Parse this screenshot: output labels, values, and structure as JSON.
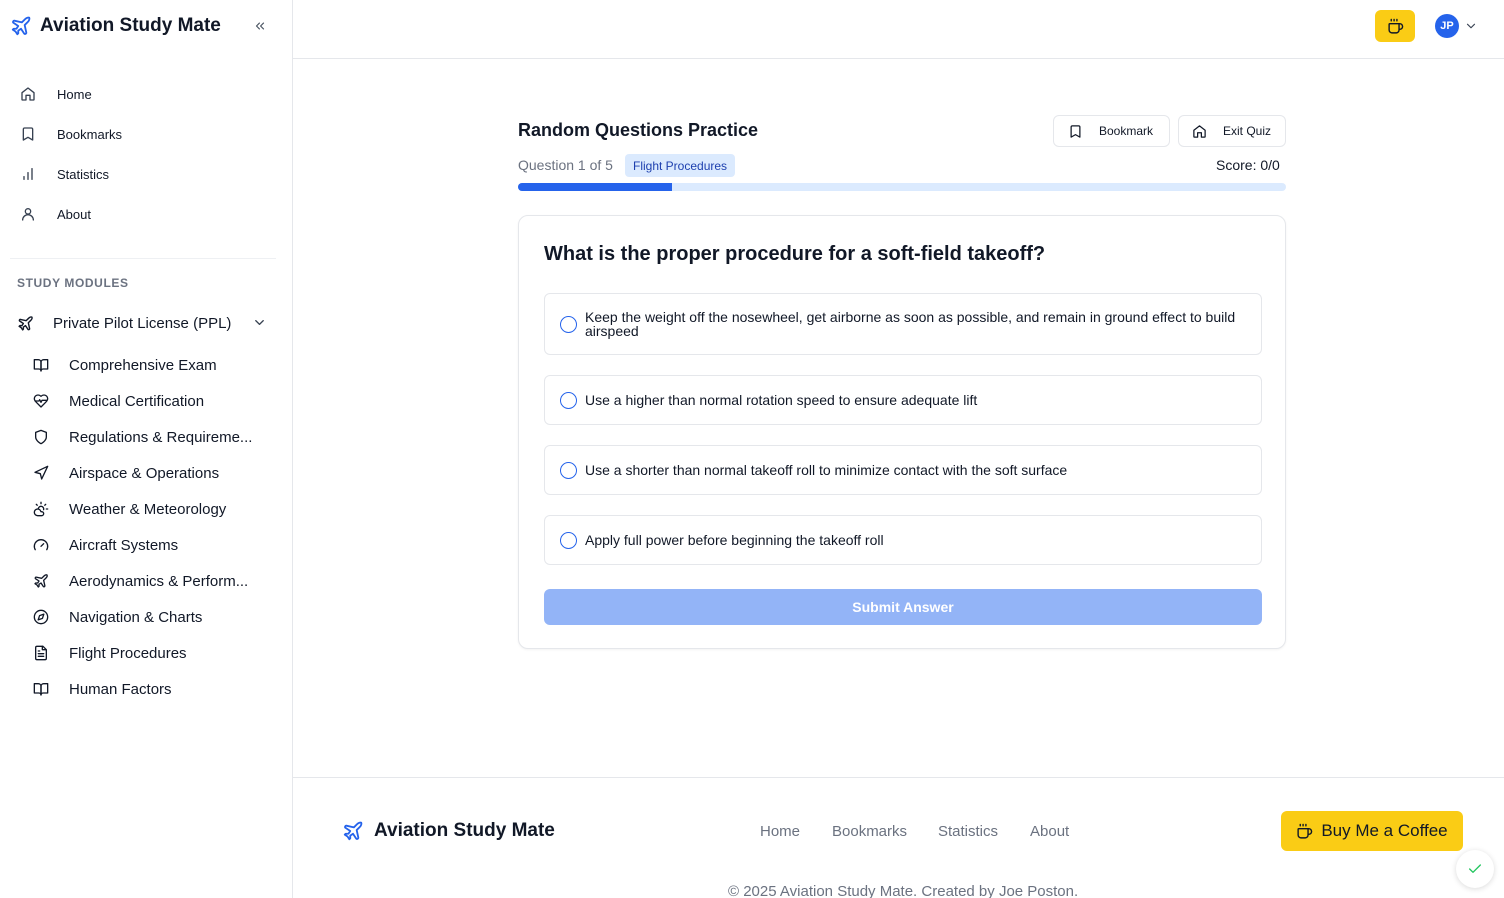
{
  "app": {
    "title": "Aviation Study Mate"
  },
  "colors": {
    "primary": "#2563eb",
    "accent": "#facc15",
    "badge_bg": "#dbeafe",
    "submit_disabled": "#93b4f7"
  },
  "sidebar": {
    "nav": [
      {
        "label": "Home",
        "icon": "home-icon"
      },
      {
        "label": "Bookmarks",
        "icon": "bookmark-icon"
      },
      {
        "label": "Statistics",
        "icon": "bar-chart-icon"
      },
      {
        "label": "About",
        "icon": "user-icon"
      }
    ],
    "modules_heading": "STUDY MODULES",
    "module_group": {
      "label": "Private Pilot License (PPL)",
      "icon": "plane-icon"
    },
    "modules": [
      {
        "label": "Comprehensive Exam",
        "icon": "book-open-icon"
      },
      {
        "label": "Medical Certification",
        "icon": "heart-pulse-icon"
      },
      {
        "label": "Regulations & Requireme...",
        "icon": "shield-icon"
      },
      {
        "label": "Airspace & Operations",
        "icon": "navigation-icon"
      },
      {
        "label": "Weather & Meteorology",
        "icon": "cloud-sun-icon"
      },
      {
        "label": "Aircraft Systems",
        "icon": "gauge-icon"
      },
      {
        "label": "Aerodynamics & Perform...",
        "icon": "plane-icon"
      },
      {
        "label": "Navigation & Charts",
        "icon": "compass-icon"
      },
      {
        "label": "Flight Procedures",
        "icon": "file-text-icon"
      },
      {
        "label": "Human Factors",
        "icon": "book-open-icon"
      }
    ]
  },
  "topbar": {
    "avatar_initials": "JP"
  },
  "quiz": {
    "title": "Random Questions Practice",
    "bookmark_label": "Bookmark",
    "exit_label": "Exit Quiz",
    "question_counter": "Question 1 of 5",
    "category": "Flight Procedures",
    "score": "Score: 0/0",
    "progress": 0.2,
    "question": "What is the proper procedure for a soft-field takeoff?",
    "options": [
      "Keep the weight off the nosewheel, get airborne as soon as possible, and remain in ground effect to build airspeed",
      "Use a higher than normal rotation speed to ensure adequate lift",
      "Use a shorter than normal takeoff roll to minimize contact with the soft surface",
      "Apply full power before beginning the takeoff roll"
    ],
    "submit_label": "Submit Answer"
  },
  "footer": {
    "title": "Aviation Study Mate",
    "links": [
      "Home",
      "Bookmarks",
      "Statistics",
      "About"
    ],
    "coffee_label": "Buy Me a Coffee",
    "copyright": "© 2025 Aviation Study Mate. Created by Joe Poston."
  }
}
